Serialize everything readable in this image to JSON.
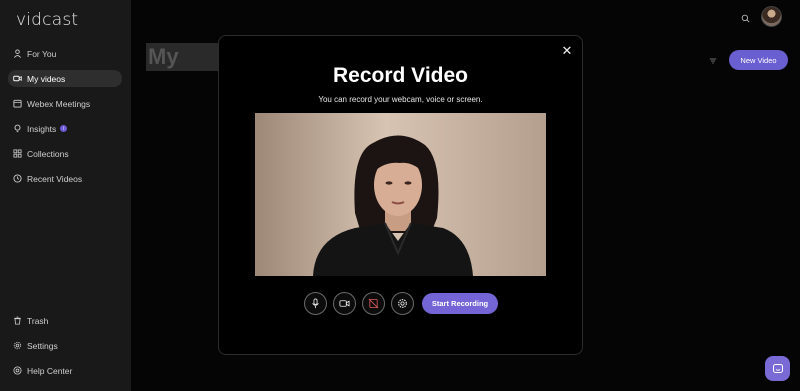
{
  "app": {
    "logo": "vidcast"
  },
  "sidebar": {
    "items": [
      {
        "label": "For You",
        "icon": "person-icon"
      },
      {
        "label": "My videos",
        "icon": "video-camera-icon",
        "active": true
      },
      {
        "label": "Webex Meetings",
        "icon": "calendar-icon"
      },
      {
        "label": "Insights",
        "icon": "lightbulb-icon",
        "badge": "i"
      },
      {
        "label": "Collections",
        "icon": "grid-icon"
      },
      {
        "label": "Recent Videos",
        "icon": "clock-icon"
      }
    ],
    "bottom_items": [
      {
        "label": "Trash",
        "icon": "trash-icon"
      },
      {
        "label": "Settings",
        "icon": "gear-icon"
      },
      {
        "label": "Help Center",
        "icon": "help-icon"
      }
    ]
  },
  "main": {
    "page_title": "My Vide",
    "new_video_label": "New Video"
  },
  "modal": {
    "title": "Record Video",
    "subtitle": "You can record your webcam, voice or screen.",
    "start_label": "Start Recording",
    "close_glyph": "✕"
  },
  "colors": {
    "accent": "#7365d6",
    "sidebar_bg": "#191919",
    "active_item_bg": "#2e2e2e",
    "screen_off_red": "#e05a5a"
  }
}
